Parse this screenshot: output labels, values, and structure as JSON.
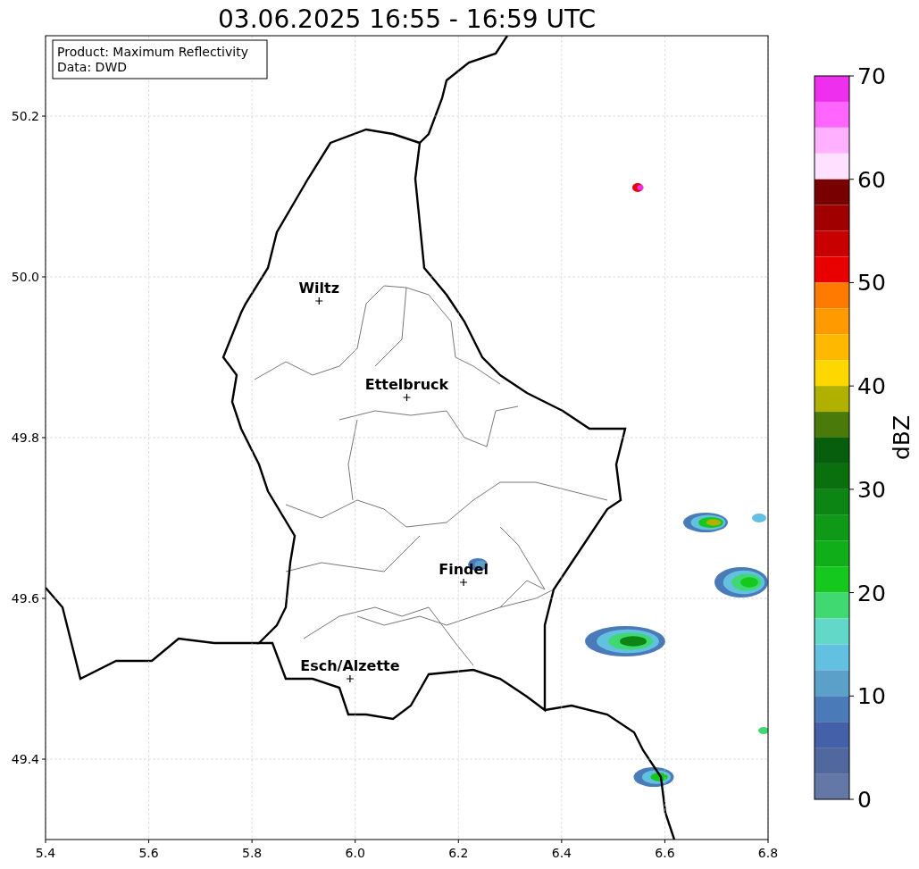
{
  "chart_data": {
    "type": "scatter",
    "title": "03.06.2025 16:55 - 16:59 UTC",
    "xlim": [
      5.4,
      6.8
    ],
    "ylim": [
      49.3,
      50.3
    ],
    "grid": true,
    "xticks": [
      {
        "value": 5.4,
        "label": "5.4"
      },
      {
        "value": 5.6,
        "label": "5.6"
      },
      {
        "value": 5.8,
        "label": "5.8"
      },
      {
        "value": 6.0,
        "label": "6.0"
      },
      {
        "value": 6.2,
        "label": "6.2"
      },
      {
        "value": 6.4,
        "label": "6.4"
      },
      {
        "value": 6.6,
        "label": "6.6"
      },
      {
        "value": 6.8,
        "label": "6.8"
      }
    ],
    "yticks": [
      {
        "value": 49.4,
        "label": "49.4"
      },
      {
        "value": 49.6,
        "label": "49.6"
      },
      {
        "value": 49.8,
        "label": "49.8"
      },
      {
        "value": 50.0,
        "label": "50.0"
      },
      {
        "value": 50.2,
        "label": "50.2"
      }
    ],
    "series": [
      {
        "color": "#000000",
        "x": [
          5.93,
          6.1,
          6.21,
          5.99
        ],
        "values": [
          49.97,
          49.85,
          49.62,
          49.5
        ]
      }
    ],
    "annotations": [
      {
        "text": "Wiltz",
        "x": 5.93,
        "y": 49.97
      },
      {
        "text": "Ettelbruck",
        "x": 6.1,
        "y": 49.85
      },
      {
        "text": "Findel",
        "x": 6.21,
        "y": 49.62
      },
      {
        "text": "Esch/Alzette",
        "x": 5.99,
        "y": 49.5
      }
    ]
  },
  "info": [
    "Product: Maximum Reflectivity",
    "Data: DWD"
  ],
  "colorbar": {
    "label": "dBZ",
    "ticks": [
      "70",
      "60",
      "50",
      "40",
      "30",
      "20",
      "10",
      "0"
    ],
    "segments": [
      {
        "color": "#ee30ee"
      },
      {
        "color": "#ff66ff"
      },
      {
        "color": "#ffb0ff"
      },
      {
        "color": "#ffe0ff"
      },
      {
        "color": "#780000"
      },
      {
        "color": "#a00000"
      },
      {
        "color": "#c80000"
      },
      {
        "color": "#e80000"
      },
      {
        "color": "#ff7a00"
      },
      {
        "color": "#ff9a00"
      },
      {
        "color": "#ffb800"
      },
      {
        "color": "#ffd700"
      },
      {
        "color": "#b0b000"
      },
      {
        "color": "#4a7a0a"
      },
      {
        "color": "#075e0c"
      },
      {
        "color": "#0a700e"
      },
      {
        "color": "#0c8514"
      },
      {
        "color": "#0e9a16"
      },
      {
        "color": "#10ae18"
      },
      {
        "color": "#14c81e"
      },
      {
        "color": "#40d870"
      },
      {
        "color": "#62d8c8"
      },
      {
        "color": "#62c0e0"
      },
      {
        "color": "#5aa0c8"
      },
      {
        "color": "#4a7ab8"
      },
      {
        "color": "#4460a8"
      },
      {
        "color": "#50689e"
      },
      {
        "color": "#6478a8"
      }
    ]
  }
}
